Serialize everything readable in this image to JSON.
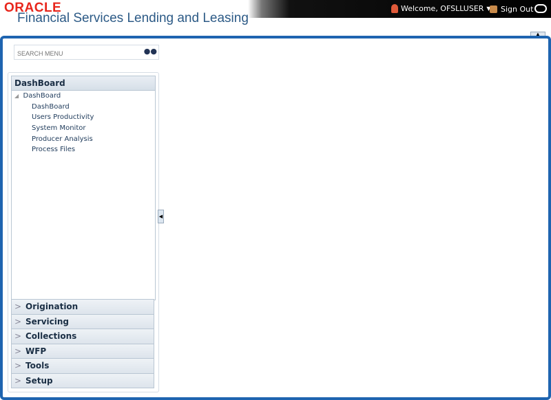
{
  "header": {
    "logo": "ORACLE",
    "app_name": "Financial Services Lending and Leasing",
    "welcome": "Welcome, OFSLLUSER",
    "sign_out": "Sign Out"
  },
  "search": {
    "placeholder": "SEARCH MENU"
  },
  "dashboard": {
    "title": "DashBoard",
    "root": "DashBoard",
    "items": [
      "DashBoard",
      "Users Productivity",
      "System Monitor",
      "Producer Analysis",
      "Process Files"
    ]
  },
  "accordion": [
    "Origination",
    "Servicing",
    "Collections",
    "WFP",
    "Tools",
    "Setup"
  ]
}
